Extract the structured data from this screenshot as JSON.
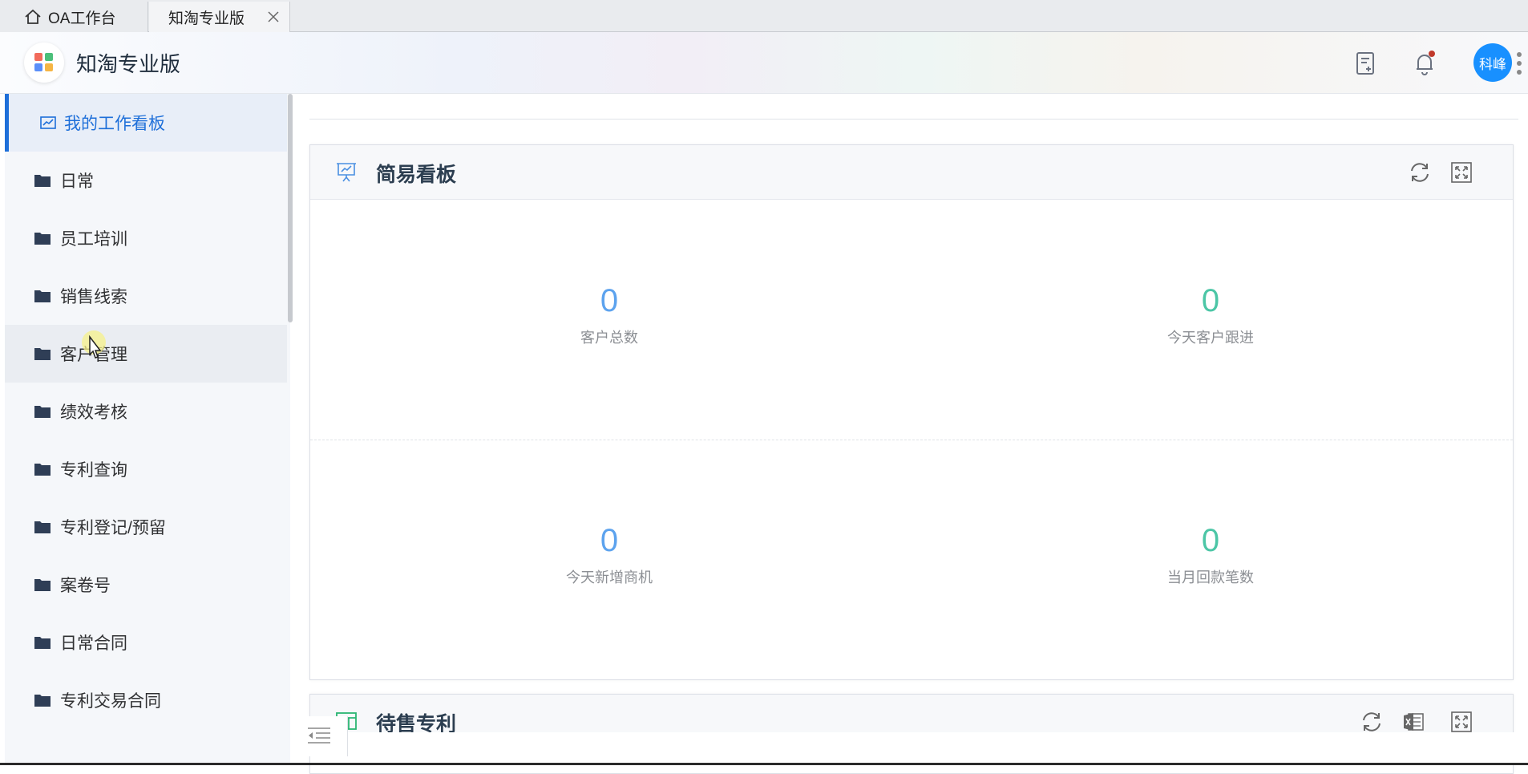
{
  "browser_tabs": [
    {
      "label": "OA工作台"
    },
    {
      "label": "知淘专业版"
    }
  ],
  "header": {
    "app_title": "知淘专业版",
    "avatar_text": "科峰"
  },
  "sidebar": {
    "items": [
      {
        "label": "我的工作看板",
        "icon": "chart-icon",
        "active": true
      },
      {
        "label": "日常",
        "icon": "folder-icon"
      },
      {
        "label": "员工培训",
        "icon": "folder-icon"
      },
      {
        "label": "销售线索",
        "icon": "folder-icon"
      },
      {
        "label": "客户管理",
        "icon": "folder-icon"
      },
      {
        "label": "绩效考核",
        "icon": "folder-icon"
      },
      {
        "label": "专利查询",
        "icon": "folder-icon"
      },
      {
        "label": "专利登记/预留",
        "icon": "folder-icon"
      },
      {
        "label": "案卷号",
        "icon": "folder-icon"
      },
      {
        "label": "日常合同",
        "icon": "folder-icon"
      },
      {
        "label": "专利交易合同",
        "icon": "folder-icon"
      }
    ]
  },
  "dashboard": {
    "title": "简易看板",
    "stats": [
      {
        "value": "0",
        "label": "客户总数",
        "color": "#5da3ee"
      },
      {
        "value": "0",
        "label": "今天客户跟进",
        "color": "#4cc6a6"
      },
      {
        "value": "0",
        "label": "今天新增商机",
        "color": "#5da3ee"
      },
      {
        "value": "0",
        "label": "当月回款笔数",
        "color": "#4cc6a6"
      }
    ]
  },
  "second_card": {
    "title": "待售专利"
  },
  "colors": {
    "accent": "#1e6fd9",
    "avatar_bg": "#1890ff",
    "sidebar_bg": "#f5f7fa"
  }
}
